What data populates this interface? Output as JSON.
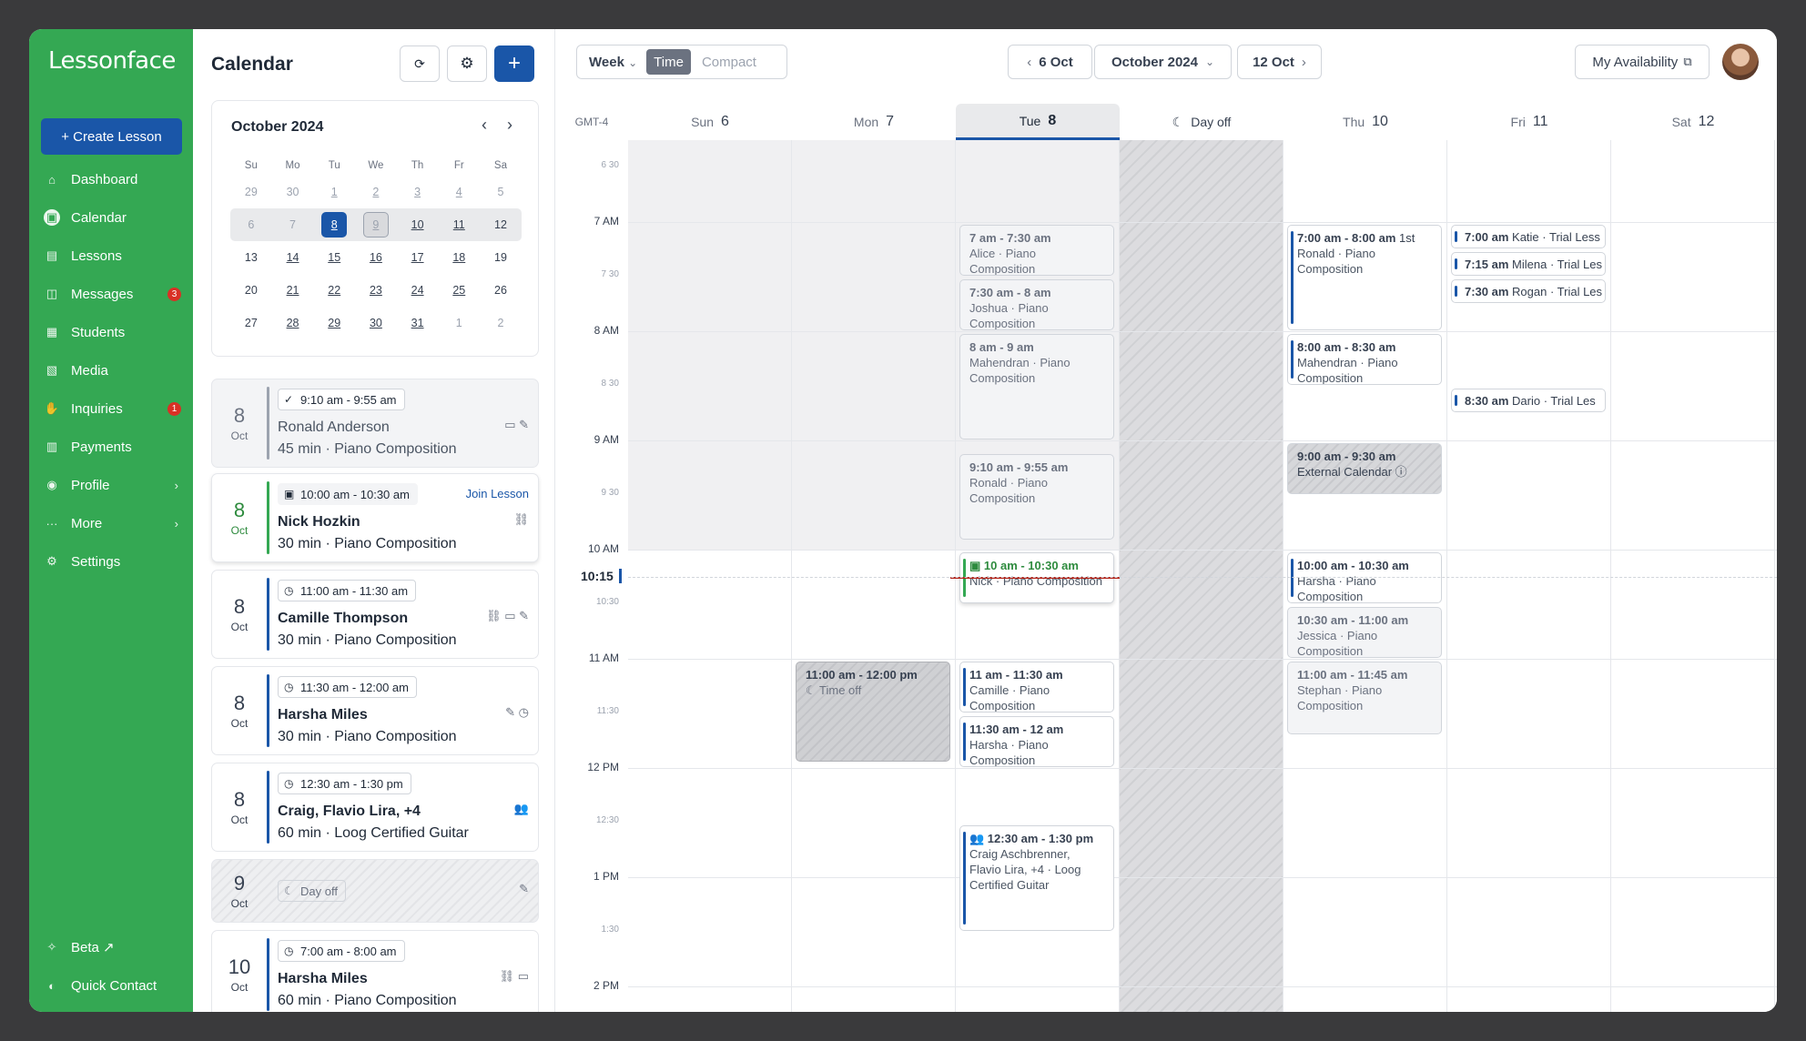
{
  "app": {
    "logo": "Lessonface",
    "create_label": "+ Create Lesson"
  },
  "nav": [
    {
      "label": "Dashboard",
      "icon": "home-icon"
    },
    {
      "label": "Calendar",
      "icon": "calendar-icon",
      "active": true
    },
    {
      "label": "Lessons",
      "icon": "lessons-icon"
    },
    {
      "label": "Messages",
      "icon": "messages-icon",
      "badge": "3"
    },
    {
      "label": "Students",
      "icon": "students-icon"
    },
    {
      "label": "Media",
      "icon": "media-icon"
    },
    {
      "label": "Inquiries",
      "icon": "inquiries-icon",
      "badge": "1"
    },
    {
      "label": "Payments",
      "icon": "payments-icon"
    },
    {
      "label": "Profile",
      "icon": "profile-icon",
      "chevron": true
    },
    {
      "label": "More",
      "icon": "more-icon",
      "chevron": true
    },
    {
      "label": "Settings",
      "icon": "settings-icon"
    }
  ],
  "nav_bottom": [
    {
      "label": "Beta ↗",
      "icon": "beta-icon"
    },
    {
      "label": "Quick Contact",
      "icon": "contact-icon"
    }
  ],
  "panel": {
    "title": "Calendar"
  },
  "mini_calendar": {
    "title": "October 2024",
    "weekdays": [
      "Su",
      "Mo",
      "Tu",
      "We",
      "Th",
      "Fr",
      "Sa"
    ],
    "weeks": [
      [
        "29",
        "30",
        "1",
        "2",
        "3",
        "4",
        "5"
      ],
      [
        "6",
        "7",
        "8",
        "9",
        "10",
        "11",
        "12"
      ],
      [
        "13",
        "14",
        "15",
        "16",
        "17",
        "18",
        "19"
      ],
      [
        "20",
        "21",
        "22",
        "23",
        "24",
        "25",
        "26"
      ],
      [
        "27",
        "28",
        "29",
        "30",
        "31",
        "1",
        "2"
      ]
    ]
  },
  "lessons": [
    {
      "day": "8",
      "month": "Oct",
      "time": "9:10 am - 9:55 am",
      "name": "Ronald Anderson",
      "sub": "45 min · Piano Composition",
      "state": "past",
      "icons": "▭ ✎"
    },
    {
      "day": "8",
      "month": "Oct",
      "time": "10:00 am - 10:30 am",
      "name": "Nick Hozkin",
      "sub": "30 min · Piano Composition",
      "state": "active",
      "join": "Join Lesson",
      "icons": "⛓"
    },
    {
      "day": "8",
      "month": "Oct",
      "time": "11:00 am - 11:30 am",
      "name": "Camille Thompson",
      "sub": "30 min · Piano Composition",
      "icons": "⛓ ▭ ✎"
    },
    {
      "day": "8",
      "month": "Oct",
      "time": "11:30 am - 12:00 am",
      "name": "Harsha Miles",
      "sub": "30 min · Piano Composition",
      "icons": "✎ ◷"
    },
    {
      "day": "8",
      "month": "Oct",
      "time": "12:30 am - 1:30 pm",
      "name": "Craig, Flavio Lira, +4",
      "sub": "60 min · Loog Certified Guitar",
      "icons": "👥"
    },
    {
      "day": "9",
      "month": "Oct",
      "time": "Day off",
      "state": "dayoff",
      "icons": "✎"
    },
    {
      "day": "10",
      "month": "Oct",
      "time": "7:00 am - 8:00 am",
      "name": "Harsha Miles",
      "sub": "60 min · Piano Composition",
      "icons": "⛓ ▭"
    }
  ],
  "toolbar": {
    "view": "Week",
    "mode_time": "Time",
    "mode_compact": "Compact",
    "prev": "6 Oct",
    "month": "October 2024",
    "next": "12 Oct",
    "availability": "My Availability"
  },
  "timezone": "GMT-4",
  "days": [
    {
      "name": "Sun",
      "num": "6"
    },
    {
      "name": "Mon",
      "num": "7"
    },
    {
      "name": "Tue",
      "num": "8",
      "selected": true
    },
    {
      "name": "Day off",
      "num": "",
      "dayoff": true
    },
    {
      "name": "Thu",
      "num": "10"
    },
    {
      "name": "Fri",
      "num": "11"
    },
    {
      "name": "Sat",
      "num": "12"
    }
  ],
  "time_labels": [
    {
      "label": "6 30",
      "half": true
    },
    {
      "label": "7 AM"
    },
    {
      "label": "7 30",
      "half": true
    },
    {
      "label": "8 AM"
    },
    {
      "label": "8 30",
      "half": true
    },
    {
      "label": "9 AM"
    },
    {
      "label": "9 30",
      "half": true
    },
    {
      "label": "10 AM"
    },
    {
      "label": "10:30",
      "half": true
    },
    {
      "label": "11 AM"
    },
    {
      "label": "11:30",
      "half": true
    },
    {
      "label": "12 PM"
    },
    {
      "label": "12:30",
      "half": true
    },
    {
      "label": "1 PM"
    },
    {
      "label": "1:30",
      "half": true
    },
    {
      "label": "2 PM"
    }
  ],
  "now_label": "10:15",
  "events": [
    {
      "col": 2,
      "start": 7.0,
      "end": 7.5,
      "t": "7 am - 7:30 am",
      "l1": "Alice · Piano",
      "l2": "Composition",
      "style": "past"
    },
    {
      "col": 2,
      "start": 7.5,
      "end": 8.0,
      "t": "7:30 am - 8 am",
      "l1": "Joshua · Piano",
      "l2": "Composition",
      "style": "past"
    },
    {
      "col": 2,
      "start": 8.0,
      "end": 9.0,
      "t": "8 am - 9 am",
      "l1": "Mahendran · Piano",
      "l2": "Composition",
      "style": "past"
    },
    {
      "col": 2,
      "start": 9.1,
      "end": 9.92,
      "t": "9:10 am - 9:55 am",
      "l1": "Ronald · Piano",
      "l2": "Composition",
      "style": "past"
    },
    {
      "col": 2,
      "start": 10.0,
      "end": 10.5,
      "t": "▣ 10 am - 10:30 am",
      "l1": "Nick · Piano Composition",
      "style": "gbar"
    },
    {
      "col": 2,
      "start": 11.0,
      "end": 11.5,
      "t": "11 am - 11:30 am",
      "l1": "Camille · Piano",
      "l2": "Composition",
      "style": "bar"
    },
    {
      "col": 2,
      "start": 11.5,
      "end": 12.0,
      "t": "11:30 am - 12 am",
      "l1": "Harsha · Piano",
      "l2": "Composition",
      "style": "bar"
    },
    {
      "col": 2,
      "start": 12.5,
      "end": 13.5,
      "t": "👥 12:30 am - 1:30 pm",
      "l1": "Craig Aschbrenner,",
      "l2": "Flavio Lira, +4 · Loog",
      "l3": "Certified Guitar",
      "style": "bar"
    },
    {
      "col": 1,
      "start": 11.0,
      "end": 11.95,
      "t": "11:00 am - 12:00 pm",
      "l1": "☾ Time off",
      "style": "timeoff"
    },
    {
      "col": 4,
      "start": 7.0,
      "end": 8.0,
      "t": "7:00 am - 8:00 am",
      "tx": " 1st",
      "l1": "Ronald · Piano",
      "l2": "Composition",
      "style": "bar"
    },
    {
      "col": 4,
      "start": 8.0,
      "end": 8.5,
      "t": "8:00 am - 8:30 am",
      "l1": "Mahendran · Piano",
      "l2": "Composition",
      "style": "bar"
    },
    {
      "col": 4,
      "start": 9.0,
      "end": 9.5,
      "t": "9:00 am - 9:30 am",
      "l1": "External Calendar ⓘ",
      "style": "ext"
    },
    {
      "col": 4,
      "start": 10.0,
      "end": 10.5,
      "t": "10:00 am - 10:30 am",
      "l1": "Harsha · Piano",
      "l2": "Composition",
      "style": "bar"
    },
    {
      "col": 4,
      "start": 10.5,
      "end": 11.0,
      "t": "10:30 am - 11:00 am",
      "l1": "Jessica · Piano",
      "l2": "Composition",
      "style": "past"
    },
    {
      "col": 4,
      "start": 11.0,
      "end": 11.7,
      "t": "11:00 am - 11:45 am",
      "l1": "Stephan · Piano",
      "l2": "Composition",
      "style": "past"
    },
    {
      "col": 5,
      "start": 7.0,
      "end": 7.25,
      "t": "7:00 am",
      "tx": " Katie · Trial Less",
      "style": "small"
    },
    {
      "col": 5,
      "start": 7.25,
      "end": 7.5,
      "t": "7:15 am",
      "tx": " Milena · Trial Les",
      "style": "small"
    },
    {
      "col": 5,
      "start": 7.5,
      "end": 7.75,
      "t": "7:30 am",
      "tx": " Rogan · Trial Les",
      "style": "small"
    },
    {
      "col": 5,
      "start": 8.5,
      "end": 8.75,
      "t": "8:30 am",
      "tx": " Dario · Trial Les",
      "style": "small"
    }
  ]
}
